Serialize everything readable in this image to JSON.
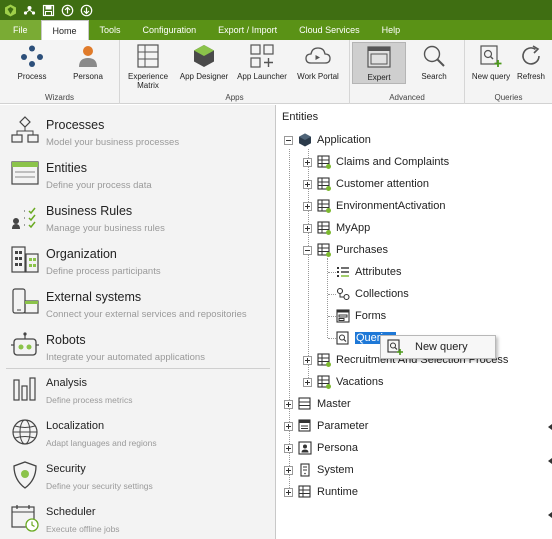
{
  "colors": {
    "titlebar": "#3f6e12",
    "tabbar": "#5a9216",
    "accent_green": "#7cb82f",
    "selection": "#1e78d7"
  },
  "ribbon": {
    "tabs": [
      {
        "label": "File"
      },
      {
        "label": "Home"
      },
      {
        "label": "Tools"
      },
      {
        "label": "Configuration"
      },
      {
        "label": "Export / Import"
      },
      {
        "label": "Cloud Services"
      },
      {
        "label": "Help"
      }
    ],
    "groups": {
      "wizards": {
        "title": "Wizards",
        "buttons": [
          {
            "label": "Process",
            "icon": "process-icon"
          },
          {
            "label": "Persona",
            "icon": "persona-icon"
          }
        ]
      },
      "apps": {
        "title": "Apps",
        "buttons": [
          {
            "label": "Experience Matrix",
            "icon": "matrix-icon"
          },
          {
            "label": "App Designer",
            "icon": "app-designer-icon"
          },
          {
            "label": "App Launcher",
            "icon": "app-launcher-icon"
          },
          {
            "label": "Work Portal",
            "icon": "cloud-icon"
          }
        ]
      },
      "advanced": {
        "title": "Advanced",
        "buttons": [
          {
            "label": "Expert",
            "icon": "expert-icon"
          },
          {
            "label": "Search",
            "icon": "search-icon"
          }
        ]
      },
      "queries": {
        "title": "Queries",
        "buttons": [
          {
            "label": "New query",
            "icon": "new-query-icon"
          },
          {
            "label": "Refresh",
            "icon": "refresh-icon"
          }
        ]
      }
    }
  },
  "left_panel": {
    "items": [
      {
        "title": "Processes",
        "subtitle": "Model your business processes"
      },
      {
        "title": "Entities",
        "subtitle": "Define your process data"
      },
      {
        "title": "Business Rules",
        "subtitle": "Manage your business rules"
      },
      {
        "title": "Organization",
        "subtitle": "Define process participants"
      },
      {
        "title": "External systems",
        "subtitle": "Connect your external services and repositories"
      },
      {
        "title": "Robots",
        "subtitle": "Integrate your automated applications"
      },
      {
        "title": "Analysis",
        "subtitle": "Define process metrics"
      },
      {
        "title": "Localization",
        "subtitle": "Adapt languages and regions"
      },
      {
        "title": "Security",
        "subtitle": "Define your security settings"
      },
      {
        "title": "Scheduler",
        "subtitle": "Execute offline jobs"
      }
    ]
  },
  "tree": {
    "header": "Entities",
    "root": {
      "label": "Application"
    },
    "app_children": [
      {
        "label": "Claims and Complaints"
      },
      {
        "label": "Customer attention"
      },
      {
        "label": "EnvironmentActivation"
      },
      {
        "label": "MyApp"
      },
      {
        "label": "Purchases"
      }
    ],
    "purchases_children": [
      {
        "label": "Attributes"
      },
      {
        "label": "Collections"
      },
      {
        "label": "Forms"
      },
      {
        "label": "Queries"
      }
    ],
    "after_purchases": [
      {
        "label": "Recruitment And Selection Process"
      },
      {
        "label": "Vacations"
      }
    ],
    "top_level": [
      {
        "label": "Master"
      },
      {
        "label": "Parameter"
      },
      {
        "label": "Persona"
      },
      {
        "label": "System"
      },
      {
        "label": "Runtime"
      }
    ]
  },
  "context_menu": {
    "items": [
      {
        "label": "New query",
        "icon": "new-query-icon"
      }
    ]
  }
}
